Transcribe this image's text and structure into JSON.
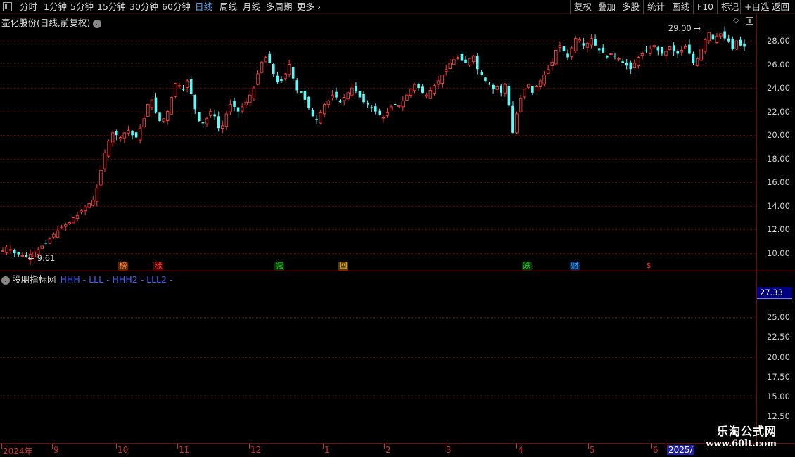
{
  "toolbar": {
    "periods": [
      "分时",
      "1分钟",
      "5分钟",
      "15分钟",
      "30分钟",
      "60分钟",
      "日线",
      "周线",
      "月线",
      "多周期",
      "更多"
    ],
    "active_index": 6,
    "right_buttons": [
      "复权",
      "叠加",
      "多股",
      "统计",
      "画线",
      "F10",
      "标记",
      "+自选",
      "返回"
    ]
  },
  "main_chart": {
    "title": "壶化股份(日线,前复权)",
    "price_ticks": [
      "28.00",
      "26.00",
      "24.00",
      "22.00",
      "20.00",
      "18.00",
      "16.00",
      "14.00",
      "12.00",
      "10.00"
    ],
    "high_annotation": "29.00",
    "low_annotation": "9.61",
    "markers": [
      {
        "label": "榜",
        "color": "#ff8040",
        "bg": "#5a2a00"
      },
      {
        "label": "涨",
        "color": "#ff4040",
        "bg": "#4a0000"
      },
      {
        "label": "减",
        "color": "#40c040",
        "bg": "#003a00"
      },
      {
        "label": "回",
        "color": "#ffd040",
        "bg": "#5a3a00"
      },
      {
        "label": "跌",
        "color": "#40c040",
        "bg": "#003a00"
      },
      {
        "label": "财",
        "color": "#40a0ff",
        "bg": "#002a5a"
      },
      {
        "label": "$",
        "color": "#ff3030",
        "bg": "transparent"
      }
    ]
  },
  "sub_chart": {
    "title": "股朋指标网",
    "legend": "HHH - LLL - HHH2 - LLL2 -",
    "current_value": "27.33",
    "ticks": [
      "25.00",
      "22.50",
      "20.00",
      "17.50",
      "15.00",
      "12.50"
    ]
  },
  "time_axis": [
    "2024年",
    "9",
    "10",
    "11",
    "12",
    "1",
    "2",
    "3",
    "4",
    "5",
    "6",
    "2025/"
  ],
  "watermark": {
    "line1": "乐淘公式网",
    "line2": "www.60lt.com"
  },
  "colors": {
    "up": "#ff3c3c",
    "down": "#54ffff",
    "grid": "#6b0000",
    "border": "#8b0000"
  },
  "chart_data": {
    "type": "candlestick",
    "ylim": [
      9.0,
      29.5
    ],
    "closes": [
      10.2,
      10.5,
      10.3,
      10.0,
      9.9,
      9.8,
      9.7,
      9.9,
      10.1,
      10.3,
      10.6,
      10.8,
      11.2,
      11.6,
      11.9,
      12.2,
      12.4,
      12.6,
      13.0,
      13.2,
      13.6,
      13.9,
      14.2,
      14.5,
      15.5,
      17.0,
      18.5,
      19.5,
      20.2,
      20.0,
      19.8,
      20.2,
      20.4,
      20.0,
      19.8,
      20.6,
      21.4,
      22.6,
      23.0,
      21.9,
      21.2,
      21.4,
      22.0,
      23.2,
      24.4,
      24.2,
      23.9,
      24.6,
      23.5,
      22.2,
      21.2,
      21.0,
      21.4,
      22.0,
      21.6,
      20.6,
      20.8,
      21.8,
      22.6,
      22.4,
      22.0,
      22.4,
      22.8,
      23.4,
      24.0,
      25.2,
      26.2,
      26.6,
      26.1,
      25.2,
      24.5,
      24.6,
      25.2,
      26.0,
      24.8,
      23.8,
      23.6,
      23.0,
      22.3,
      21.6,
      21.3,
      21.9,
      22.6,
      22.9,
      23.4,
      23.2,
      22.8,
      23.2,
      23.6,
      24.0,
      23.7,
      23.2,
      22.8,
      22.6,
      22.3,
      22.0,
      21.7,
      21.5,
      21.9,
      22.4,
      22.6,
      22.5,
      22.9,
      23.4,
      23.9,
      24.3,
      24.0,
      23.6,
      23.4,
      23.8,
      24.2,
      24.6,
      25.1,
      25.6,
      26.1,
      26.4,
      26.6,
      26.3,
      26.1,
      26.5,
      26.7,
      25.6,
      25.1,
      24.6,
      24.3,
      23.9,
      24.1,
      23.6,
      24.3,
      22.5,
      20.2,
      21.8,
      23.1,
      23.9,
      24.3,
      23.6,
      24.1,
      24.6,
      25.1,
      25.6,
      26.2,
      27.2,
      27.6,
      27.1,
      26.6,
      27.4,
      28.2,
      28.1,
      27.6,
      27.8,
      28.2,
      27.6,
      27.2,
      27.0,
      26.6,
      26.9,
      26.7,
      26.5,
      26.1,
      25.9,
      25.6,
      26.1,
      26.6,
      26.9,
      27.1,
      27.3,
      27.6,
      27.2,
      26.9,
      27.1,
      27.5,
      27.1,
      26.9,
      27.2,
      27.5,
      26.9,
      26.1,
      26.5,
      27.3,
      28.1,
      28.7,
      28.1,
      28.4,
      28.6,
      28.2,
      27.9,
      27.3,
      28.0,
      27.6,
      27.5
    ]
  }
}
